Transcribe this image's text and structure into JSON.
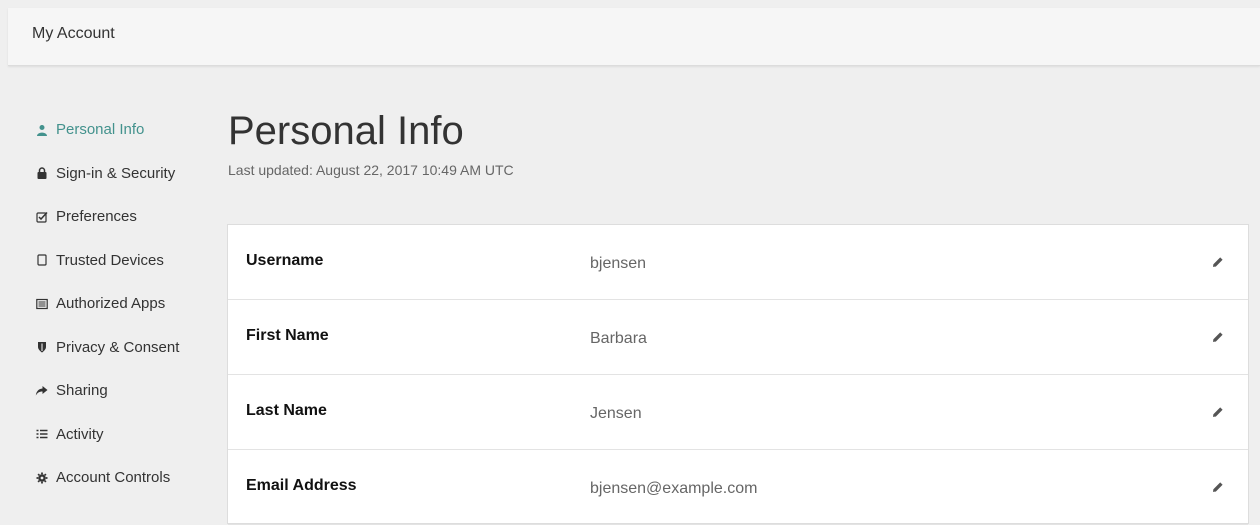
{
  "header": {
    "title": "My Account"
  },
  "sidebar": {
    "items": [
      {
        "label": "Personal Info",
        "icon": "user-icon",
        "active": true
      },
      {
        "label": "Sign-in & Security",
        "icon": "lock-icon",
        "active": false
      },
      {
        "label": "Preferences",
        "icon": "checkbox-icon",
        "active": false
      },
      {
        "label": "Trusted Devices",
        "icon": "device-icon",
        "active": false
      },
      {
        "label": "Authorized Apps",
        "icon": "list-box-icon",
        "active": false
      },
      {
        "label": "Privacy & Consent",
        "icon": "shield-icon",
        "active": false
      },
      {
        "label": "Sharing",
        "icon": "share-arrow-icon",
        "active": false
      },
      {
        "label": "Activity",
        "icon": "list-icon",
        "active": false
      },
      {
        "label": "Account Controls",
        "icon": "gear-icon",
        "active": false
      }
    ]
  },
  "main": {
    "title": "Personal Info",
    "last_updated": "Last updated: August 22, 2017 10:49 AM UTC",
    "fields": [
      {
        "label": "Username",
        "value": "bjensen",
        "action_icon": "pencil-icon"
      },
      {
        "label": "First Name",
        "value": "Barbara",
        "action_icon": "pencil-icon"
      },
      {
        "label": "Last Name",
        "value": "Jensen",
        "action_icon": "pencil-icon"
      },
      {
        "label": "Email Address",
        "value": "bjensen@example.com",
        "action_icon": "pencil-icon"
      }
    ]
  },
  "colors": {
    "accent": "#43928d",
    "page_background": "#efefef",
    "panel_background": "#ffffff"
  }
}
